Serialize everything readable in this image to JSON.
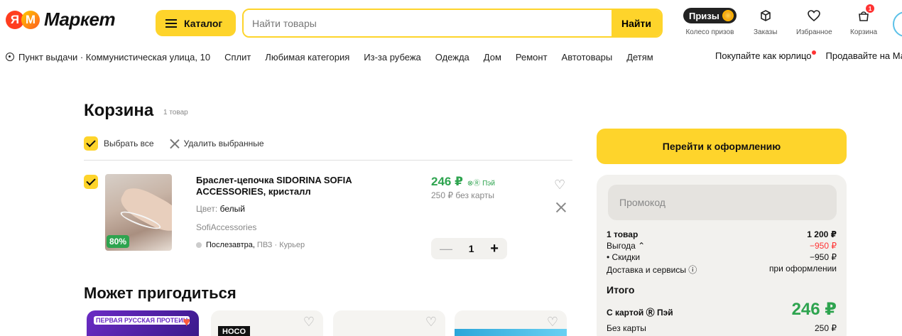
{
  "header": {
    "logo_text": "Маркет",
    "logo_letter": "Я",
    "logo_letter2": "М",
    "catalog_label": "Каталог",
    "search_placeholder": "Найти товары",
    "search_button": "Найти",
    "prizes_label": "Призы",
    "prizes_caption": "Колесо призов",
    "orders_caption": "Заказы",
    "favorites_caption": "Избранное",
    "cart_caption": "Корзина",
    "cart_badge": "1"
  },
  "subnav": {
    "pickup": "Пункт выдачи · Коммунистическая улица, 10",
    "items": [
      "Сплит",
      "Любимая категория",
      "Из-за рубежа",
      "Одежда",
      "Дом",
      "Ремонт",
      "Автотовары",
      "Детям"
    ],
    "business": "Покупайте как юрлицо",
    "sell": "Продавайте на Ма"
  },
  "cart": {
    "title": "Корзина",
    "count": "1 товар",
    "select_all": "Выбрать все",
    "delete_selected": "Удалить выбранные",
    "item": {
      "name": "Браслет-цепочка SIDORINA SOFIA ACCESSORIES, кристалл",
      "color_label": "Цвет:",
      "color_value": "белый",
      "seller": "SofiAccessories",
      "delivery_day": "Послезавтра,",
      "delivery_rest": "ПВЗ · Курьер",
      "discount": "80%",
      "price": "246 ₽",
      "pay_label": "⊗Ⓡ Пэй",
      "price_nocard": "250 ₽ без карты",
      "quantity": "1",
      "minus": "—",
      "plus": "+"
    }
  },
  "recommend": {
    "title": "Может пригодиться",
    "card1_label": "ПЕРВАЯ РУССКАЯ ПРОТЕИН",
    "card2_promo": "HOCO"
  },
  "summary": {
    "checkout_button": "Перейти к оформлению",
    "promo_placeholder": "Промокод",
    "items_label": "1 товар",
    "items_value": "1 200 ₽",
    "benefit_label": "Выгода ⌃",
    "benefit_value": "−950 ₽",
    "discounts_label": "• Скидки",
    "discounts_value": "−950 ₽",
    "delivery_label": "Доставка и сервисы ⓘ",
    "delivery_value": "при оформлении",
    "total_title": "Итого",
    "with_card_label": "С картой Ⓡ Пэй",
    "with_card_value": "246 ₽",
    "without_card_label": "Без карты",
    "without_card_value": "250 ₽"
  },
  "colors": {
    "accent": "#fed42b",
    "price_green": "#2ea44f",
    "danger": "#ff3333"
  }
}
